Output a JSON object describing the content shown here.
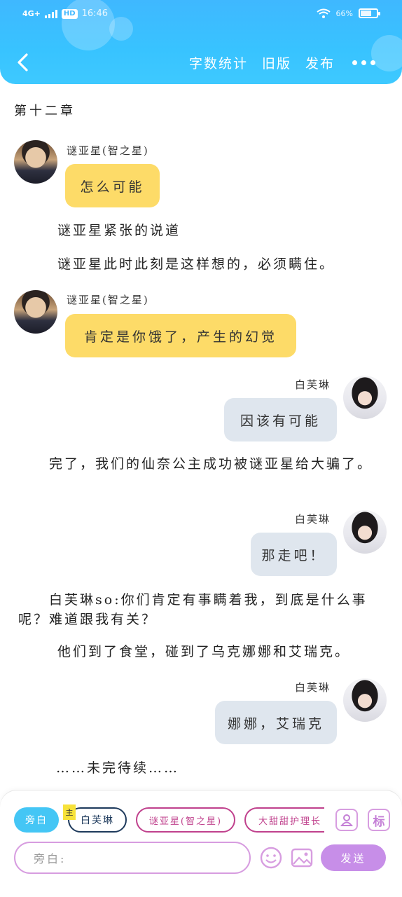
{
  "status_bar": {
    "network": "4G+",
    "hd": "HD",
    "time": "16:46",
    "battery": "66%",
    "battery_level": 0.66
  },
  "header": {
    "back": "back",
    "actions": [
      "字数统计",
      "旧版",
      "发布"
    ]
  },
  "content": {
    "chapter_title": "第十二章",
    "messages": [
      {
        "speaker": "谜亚星(智之星)",
        "text": "怎么可能"
      },
      {
        "narration": "谜亚星紧张的说道"
      },
      {
        "narration": "谜亚星此时此刻是这样想的，必须瞒住。"
      },
      {
        "speaker": "谜亚星(智之星)",
        "text": "肯定是你饿了，产生的幻觉"
      },
      {
        "speaker": "白芙琳",
        "text": "因该有可能"
      },
      {
        "narration": "　　完了，我们的仙奈公主成功被谜亚星给大骗了。"
      },
      {
        "speaker": "白芙琳",
        "text": "那走吧！"
      },
      {
        "narration": "　　白芙琳so:你们肯定有事瞒着我，到底是什么事呢？难道跟我有关？"
      },
      {
        "narration": "他们到了食堂，碰到了乌克娜娜和艾瑞克。"
      },
      {
        "speaker": "白芙琳",
        "text": "娜娜，艾瑞克"
      },
      {
        "narration": "……未完待续……"
      }
    ]
  },
  "panel": {
    "chips": [
      "旁白",
      "白芙琳",
      "谜亚星(智之星)",
      "大甜甜护理长"
    ],
    "lead_tag": "主",
    "icon_person": "person-icon",
    "icon_tag": "标",
    "input_placeholder": "旁白:",
    "send_label": "发送"
  },
  "colors": {
    "header": "#3fb8ff",
    "bubble_yellow": "#fddb68",
    "bubble_gray": "#dfe6ee",
    "accent_purple": "#c78ee8",
    "chip_pink": "#c0418d"
  }
}
